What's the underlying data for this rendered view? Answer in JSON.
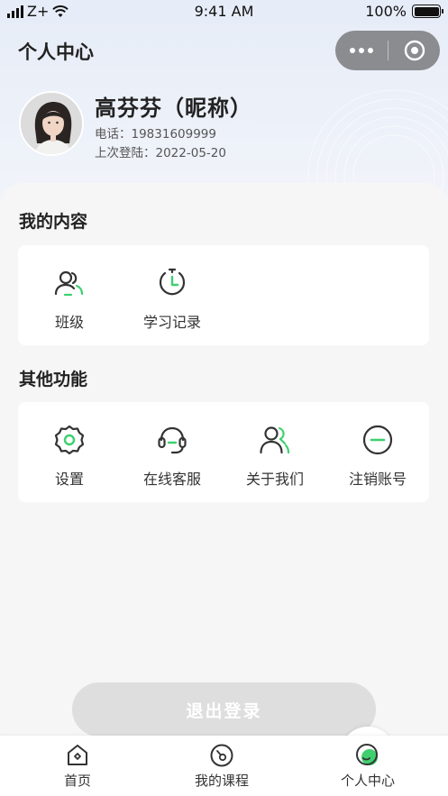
{
  "status_bar": {
    "carrier": "Z+",
    "time": "9:41 AM",
    "battery": "100%"
  },
  "nav": {
    "title": "个人中心",
    "more_icon": "more-dots-icon",
    "close_icon": "target-close-icon"
  },
  "profile": {
    "name": "高芬芬（昵称）",
    "phone": "电话：19831609999",
    "last_login": "上次登陆：2022-05-20"
  },
  "my_content": {
    "title": "我的内容",
    "items": [
      {
        "label": "班级",
        "icon": "class-people-icon"
      },
      {
        "label": "学习记录",
        "icon": "study-record-clock-icon"
      }
    ]
  },
  "other_functions": {
    "title": "其他功能",
    "items": [
      {
        "label": "设置",
        "icon": "settings-gear-icon"
      },
      {
        "label": "在线客服",
        "icon": "headset-icon"
      },
      {
        "label": "关于我们",
        "icon": "about-us-people-icon"
      },
      {
        "label": "注销账号",
        "icon": "minus-circle-icon"
      }
    ]
  },
  "logout_label": "退出登录",
  "tabbar": {
    "tabs": [
      {
        "label": "首页",
        "icon": "home-icon",
        "active": false
      },
      {
        "label": "我的课程",
        "icon": "course-icon",
        "active": false
      },
      {
        "label": "个人中心",
        "icon": "profile-icon",
        "active": true
      }
    ]
  },
  "colors": {
    "accent_green": "#3fcf6f",
    "icon_dark": "#333333",
    "capsule_bg": "#8b8c90",
    "logout_bg": "#dedede"
  }
}
